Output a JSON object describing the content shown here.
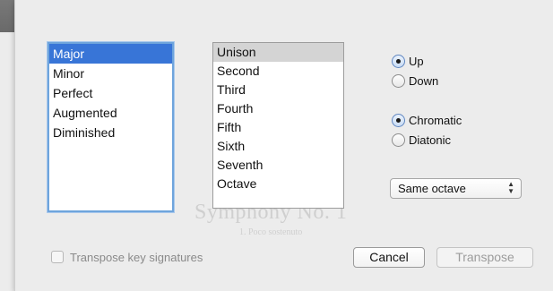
{
  "quality_list": {
    "items": [
      "Major",
      "Minor",
      "Perfect",
      "Augmented",
      "Diminished"
    ],
    "selected": "Major"
  },
  "interval_list": {
    "items": [
      "Unison",
      "Second",
      "Third",
      "Fourth",
      "Fifth",
      "Sixth",
      "Seventh",
      "Octave"
    ],
    "selected": "Unison"
  },
  "direction": {
    "options": [
      "Up",
      "Down"
    ],
    "selected": "Up"
  },
  "mode": {
    "options": [
      "Chromatic",
      "Diatonic"
    ],
    "selected": "Chromatic"
  },
  "octave_select": {
    "value": "Same octave",
    "arrows": "▲▼"
  },
  "transpose_key_signatures": {
    "label": "Transpose key signatures",
    "checked": false
  },
  "buttons": {
    "cancel": "Cancel",
    "transpose": "Transpose"
  },
  "background": {
    "score_title": "Symphony No. 1",
    "score_subtitle": "1. Poco sostenuto"
  },
  "colors": {
    "selection": "#3875d7",
    "focus_ring": "#6ea4dc"
  }
}
